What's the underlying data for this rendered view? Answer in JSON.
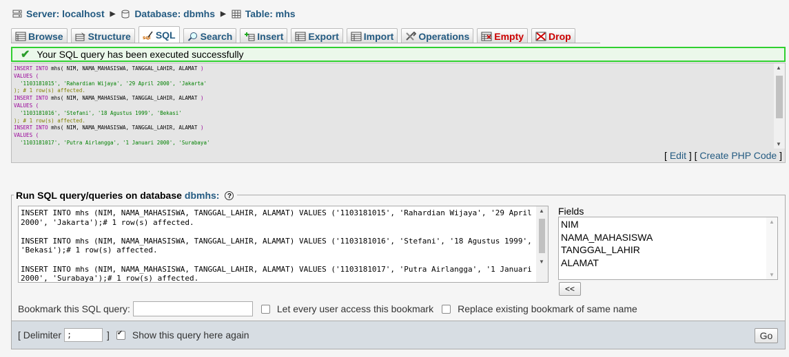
{
  "breadcrumb": {
    "server": "Server: localhost",
    "database": "Database: dbmhs",
    "table": "Table: mhs"
  },
  "tabs": [
    {
      "label": "Browse",
      "icon": "browse-icon"
    },
    {
      "label": "Structure",
      "icon": "structure-icon"
    },
    {
      "label": "SQL",
      "icon": "sql-icon"
    },
    {
      "label": "Search",
      "icon": "search-icon"
    },
    {
      "label": "Insert",
      "icon": "insert-icon"
    },
    {
      "label": "Export",
      "icon": "export-icon"
    },
    {
      "label": "Import",
      "icon": "import-icon"
    },
    {
      "label": "Operations",
      "icon": "operations-icon"
    },
    {
      "label": "Empty",
      "icon": "empty-icon"
    },
    {
      "label": "Drop",
      "icon": "drop-icon"
    }
  ],
  "success_message": "Your SQL query has been executed successfully",
  "executed_sql": {
    "lines": [
      [
        [
          "kw",
          "INSERT INTO"
        ],
        [
          "txt",
          " mhs( NIM, NAMA_MAHASISWA, TANGGAL_LAHIR, ALAMAT "
        ],
        [
          "kw",
          ")"
        ]
      ],
      [
        [
          "kw",
          "VALUES ("
        ]
      ],
      [
        [
          "str",
          "  '1103181015', 'Rahardian Wijaya', '29 April 2000', 'Jakarta'"
        ]
      ],
      [
        [
          "cm",
          "); # 1 row(s) affected."
        ]
      ],
      [
        [
          "kw",
          "INSERT INTO"
        ],
        [
          "txt",
          " mhs( NIM, NAMA_MAHASISWA, TANGGAL_LAHIR, ALAMAT "
        ],
        [
          "kw",
          ")"
        ]
      ],
      [
        [
          "kw",
          "VALUES ("
        ]
      ],
      [
        [
          "str",
          "  '1103181016', 'Stefani', '18 Agustus 1999', 'Bekasi'"
        ]
      ],
      [
        [
          "cm",
          "); # 1 row(s) affected."
        ]
      ],
      [
        [
          "kw",
          "INSERT INTO"
        ],
        [
          "txt",
          " mhs( NIM, NAMA_MAHASISWA, TANGGAL_LAHIR, ALAMAT "
        ],
        [
          "kw",
          ")"
        ]
      ],
      [
        [
          "kw",
          "VALUES ("
        ]
      ],
      [
        [
          "str",
          "  '1103181017', 'Putra Airlangga', '1 Januari 2000', 'Surabaya'"
        ]
      ]
    ]
  },
  "edit_links": {
    "edit": "Edit",
    "create_php": "Create PHP Code"
  },
  "run_sql": {
    "legend": "Run SQL query/queries on database",
    "database": "dbmhs:",
    "query_text": "INSERT INTO mhs (NIM, NAMA_MAHASISWA, TANGGAL_LAHIR, ALAMAT) VALUES ('1103181015', 'Rahardian Wijaya', '29 April 2000', 'Jakarta');# 1 row(s) affected.\n\nINSERT INTO mhs (NIM, NAMA_MAHASISWA, TANGGAL_LAHIR, ALAMAT) VALUES ('1103181016', 'Stefani', '18 Agustus 1999', 'Bekasi');# 1 row(s) affected.\n\nINSERT INTO mhs (NIM, NAMA_MAHASISWA, TANGGAL_LAHIR, ALAMAT) VALUES ('1103181017', 'Putra Airlangga', '1 Januari 2000', 'Surabaya');# 1 row(s) affected.",
    "fields_label": "Fields",
    "fields": [
      "NIM",
      "NAMA_MAHASISWA",
      "TANGGAL_LAHIR",
      "ALAMAT"
    ],
    "insert_button": "<<"
  },
  "bookmark": {
    "label": "Bookmark this SQL query:",
    "value": "",
    "every_user": "Let every user access this bookmark",
    "replace": "Replace existing bookmark of same name"
  },
  "footer": {
    "delimiter_label": "[ Delimiter",
    "delimiter_value": ";",
    "close_bracket": "]",
    "show_again": "Show this query here again",
    "go": "Go"
  },
  "colors": {
    "link": "#235a81",
    "success_border": "#2fcf2f",
    "danger": "#cc0000"
  }
}
